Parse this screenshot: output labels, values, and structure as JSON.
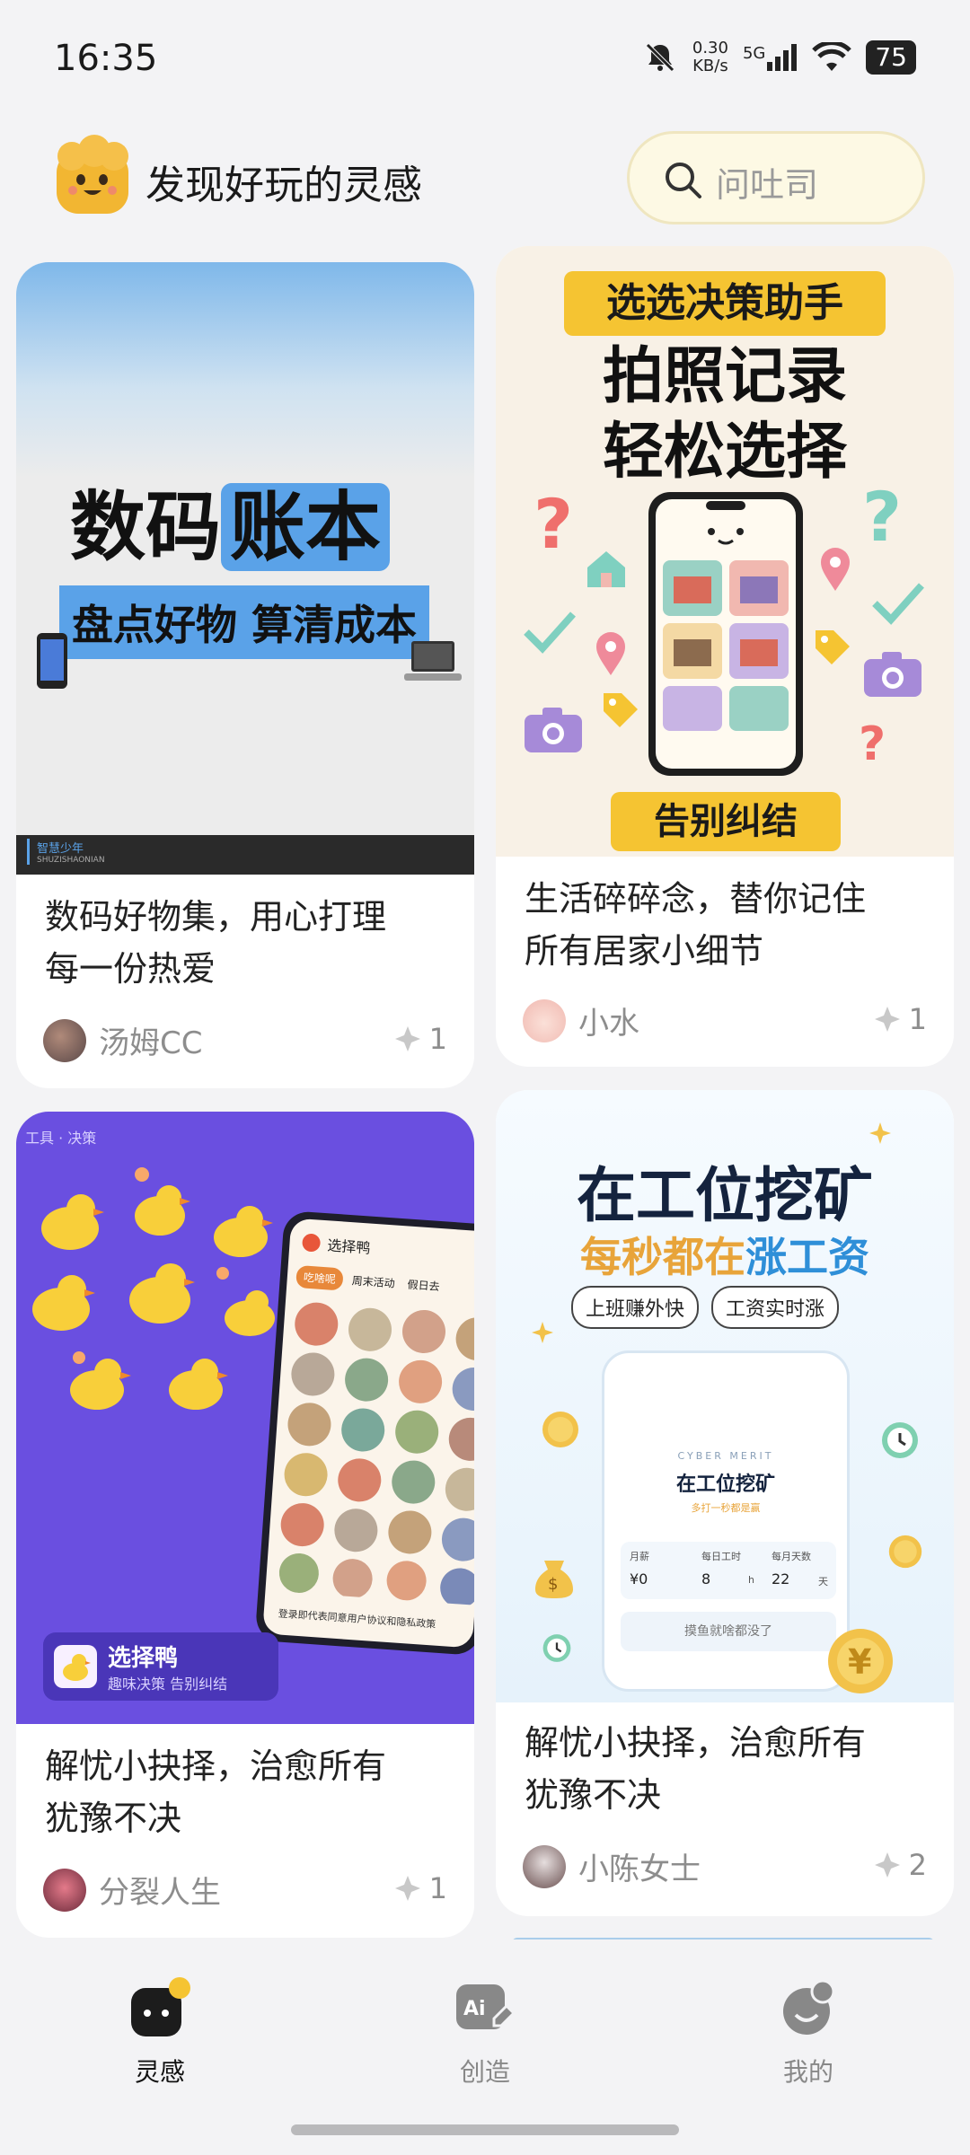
{
  "status_bar": {
    "time": "16:35",
    "net_speed": "0.30",
    "net_unit": "KB/s",
    "network": "5G",
    "battery": "75"
  },
  "header": {
    "title": "发现好玩的灵感",
    "search_placeholder": "问吐司"
  },
  "cards": [
    {
      "cover": {
        "headline_a": "数码",
        "headline_b": "账本",
        "subline": "盘点好物 算清成本",
        "brand": "智慧少年",
        "brand_sub": "SHUZISHAONIAN"
      },
      "title_lines": [
        "数码好物集，用心打理",
        "每一份热爱"
      ],
      "author": "汤姆CC",
      "likes": "1"
    },
    {
      "cover": {
        "tag": "选选决策助手",
        "line1": "拍照记录",
        "line2": "轻松选择",
        "bottom": "告别纠结"
      },
      "title_lines": [
        "生活碎碎念，替你记住",
        "所有居家小细节"
      ],
      "author": "小水",
      "likes": "1"
    },
    {
      "cover": {
        "corner": "工具 · 决策",
        "app_name": "选择鸭",
        "app_tagline": "趣味决策 告别纠结",
        "phone_title": "选择鸭",
        "chip1": "吃啥呢",
        "chip2": "周末活动",
        "chip3": "假日去",
        "footer": "登录即代表同意用户协议和隐私政策"
      },
      "title_lines": [
        "解忧小抉择，治愈所有",
        "犹豫不决"
      ],
      "author": "分裂人生",
      "likes": "1"
    },
    {
      "cover": {
        "line1": "在工位挖矿",
        "line2a": "每秒都在",
        "line2b": "涨工资",
        "pill1": "上班赚外快",
        "pill2": "工资实时涨",
        "brand": "CYBER MERIT",
        "phone_title": "在工位挖矿",
        "phone_sub": "多打一秒都是赢",
        "f1": "月薪",
        "f2": "每日工时",
        "f3": "每月天数",
        "v1": "¥0",
        "v2": "8",
        "v3": "22",
        "u2": "h",
        "u3": "天",
        "button": "摸鱼就啥都没了"
      },
      "title_lines": [
        "解忧小抉择，治愈所有",
        "犹豫不决"
      ],
      "author": "小陈女士",
      "likes": "2"
    }
  ],
  "tabs": [
    {
      "label": "灵感"
    },
    {
      "label": "创造"
    },
    {
      "label": "我的"
    }
  ]
}
